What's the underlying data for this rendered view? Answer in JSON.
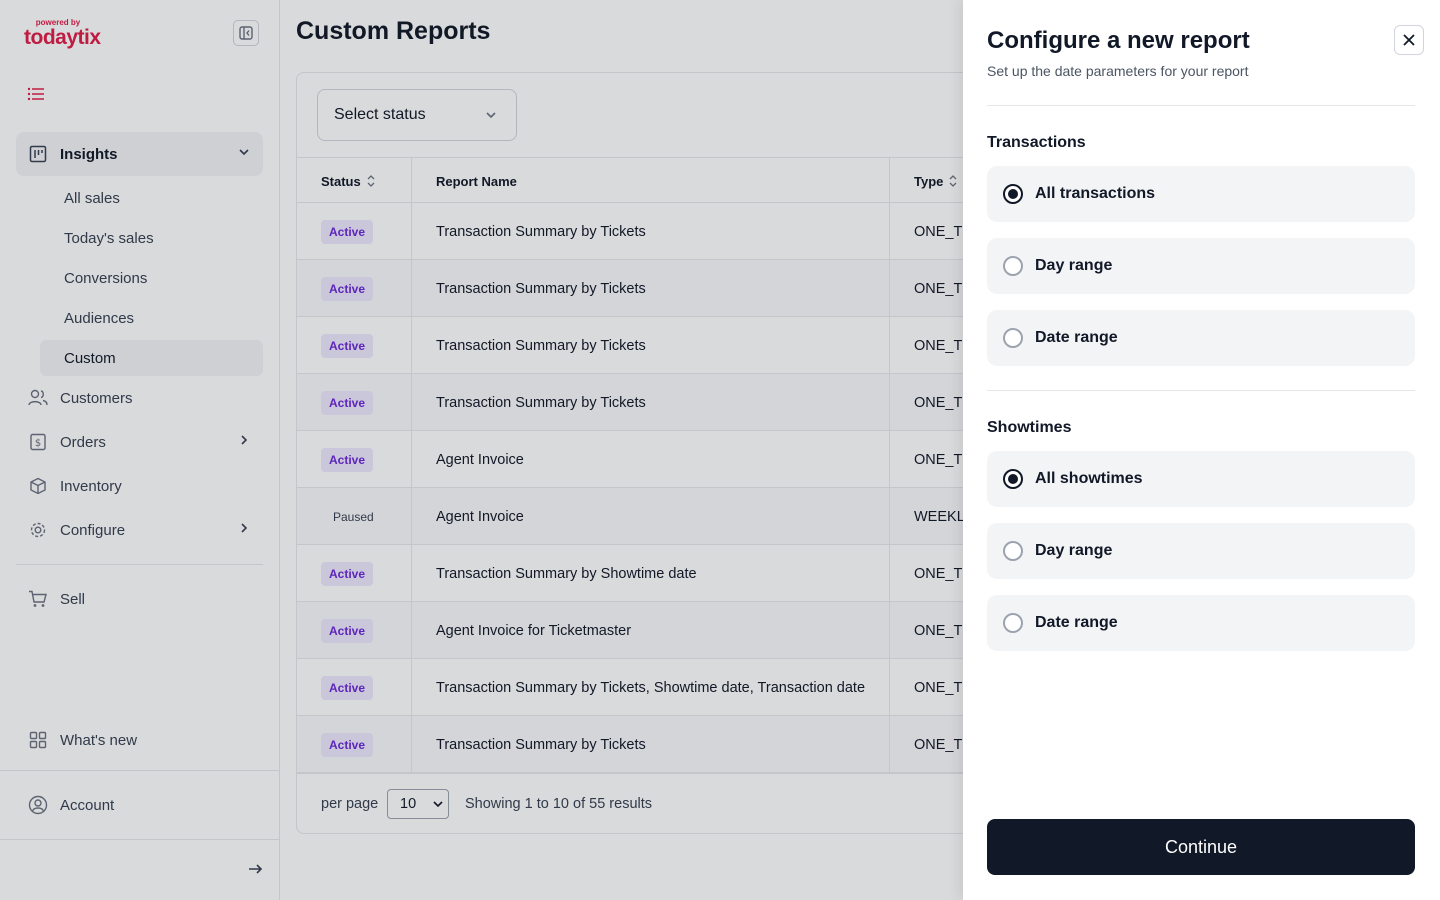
{
  "brand": {
    "powered_by": "powered by",
    "name": "todaytix",
    "color": "#e11d48"
  },
  "sidebar": {
    "insights": {
      "label": "Insights",
      "icon": "chart-icon"
    },
    "sub_items": [
      {
        "label": "All sales"
      },
      {
        "label": "Today's sales"
      },
      {
        "label": "Conversions"
      },
      {
        "label": "Audiences"
      },
      {
        "label": "Custom",
        "active": true
      }
    ],
    "items": [
      {
        "label": "Customers",
        "icon": "users-icon"
      },
      {
        "label": "Orders",
        "icon": "dollar-icon"
      },
      {
        "label": "Inventory",
        "icon": "box-icon"
      },
      {
        "label": "Configure",
        "icon": "gear-icon"
      },
      {
        "label": "Sell",
        "icon": "cart-icon"
      }
    ],
    "whats_new": "What's new",
    "account": "Account"
  },
  "main": {
    "title": "Custom Reports",
    "filter": {
      "placeholder": "Select status"
    },
    "table": {
      "columns": [
        "Status",
        "Report Name",
        "Type"
      ],
      "rows": [
        {
          "status": "Active",
          "name": "Transaction Summary by Tickets",
          "type": "ONE_TI"
        },
        {
          "status": "Active",
          "name": "Transaction Summary by Tickets",
          "type": "ONE_TI"
        },
        {
          "status": "Active",
          "name": "Transaction Summary by Tickets",
          "type": "ONE_TI"
        },
        {
          "status": "Active",
          "name": "Transaction Summary by Tickets",
          "type": "ONE_TI"
        },
        {
          "status": "Active",
          "name": "Agent Invoice",
          "type": "ONE_TI"
        },
        {
          "status": "Paused",
          "name": "Agent Invoice",
          "type": "WEEKLY"
        },
        {
          "status": "Active",
          "name": "Transaction Summary by Showtime date",
          "type": "ONE_TI"
        },
        {
          "status": "Active",
          "name": "Agent Invoice for Ticketmaster",
          "type": "ONE_TI"
        },
        {
          "status": "Active",
          "name": "Transaction Summary by Tickets, Showtime date, Transaction date",
          "type": "ONE_TI"
        },
        {
          "status": "Active",
          "name": "Transaction Summary by Tickets",
          "type": "ONE_TI"
        }
      ]
    },
    "pagination": {
      "per_page_label": "per page",
      "per_page_value": "10",
      "results": "Showing 1 to 10 of 55 results"
    }
  },
  "drawer": {
    "title": "Configure a new report",
    "subtitle": "Set up the date parameters for your report",
    "transactions": {
      "heading": "Transactions",
      "options": [
        {
          "label": "All transactions",
          "checked": true
        },
        {
          "label": "Day range",
          "checked": false
        },
        {
          "label": "Date range",
          "checked": false
        }
      ]
    },
    "showtimes": {
      "heading": "Showtimes",
      "options": [
        {
          "label": "All showtimes",
          "checked": true
        },
        {
          "label": "Day range",
          "checked": false
        },
        {
          "label": "Date range",
          "checked": false
        }
      ]
    },
    "continue_label": "Continue"
  }
}
